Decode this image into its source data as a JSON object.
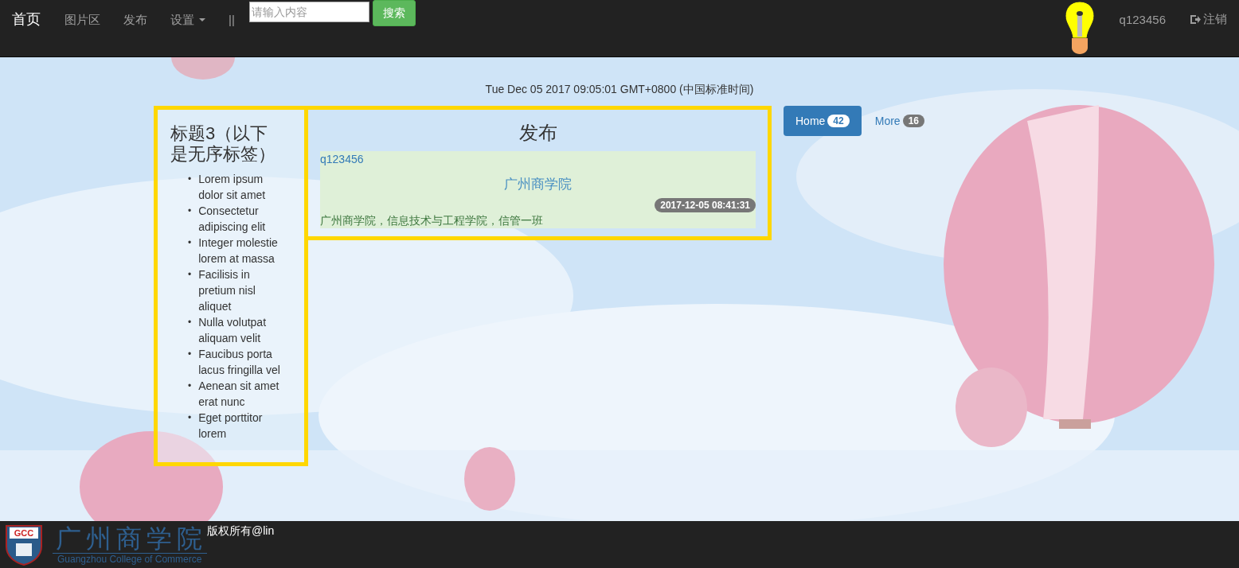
{
  "navbar": {
    "brand": "首页",
    "links": [
      {
        "label": "图片区",
        "kind": "link"
      },
      {
        "label": "发布",
        "kind": "link"
      },
      {
        "label": "设置",
        "kind": "dropdown"
      },
      {
        "label": "||",
        "kind": "link"
      }
    ],
    "search": {
      "placeholder": "请输入内容",
      "button": "搜索"
    },
    "user": "q123456",
    "logout": "注销"
  },
  "date": "Tue Dec 05 2017 09:05:01 GMT+0800 (中国标准时间)",
  "sidebar": {
    "title": "标题3（以下是无序标签）",
    "items": [
      {
        "bullet": "•",
        "text": "Lorem ipsum dolor sit amet"
      },
      {
        "bullet": "•",
        "text": "Consectetur adipiscing elit"
      },
      {
        "bullet": "•",
        "text": "Integer molestie lorem at massa"
      },
      {
        "bullet": "•",
        "text": "Facilisis in pretium nisl aliquet"
      },
      {
        "bullet": "•",
        "text": "Nulla volutpat aliquam velit"
      },
      {
        "bullet": "•",
        "text": "Faucibus porta lacus fringilla vel"
      },
      {
        "bullet": "•",
        "text": "Aenean sit amet erat nunc"
      },
      {
        "bullet": "•",
        "text": "Eget porttitor lorem"
      }
    ]
  },
  "post": {
    "heading": "发布",
    "author": "q123456",
    "title": "广州商学院",
    "time": "2017-12-05 08:41:31",
    "body": "广州商学院，信息技术与工程学院，信管一班"
  },
  "pills": [
    {
      "label": "Home",
      "count": "42",
      "selected": true
    },
    {
      "label": "More",
      "count": "16",
      "selected": false
    }
  ],
  "footer": {
    "logo_badge": "GCC",
    "logo_name": "广州商学院",
    "logo_subtitle": "Guangzhou College of Commerce",
    "copyright": "版权所有@lin"
  }
}
